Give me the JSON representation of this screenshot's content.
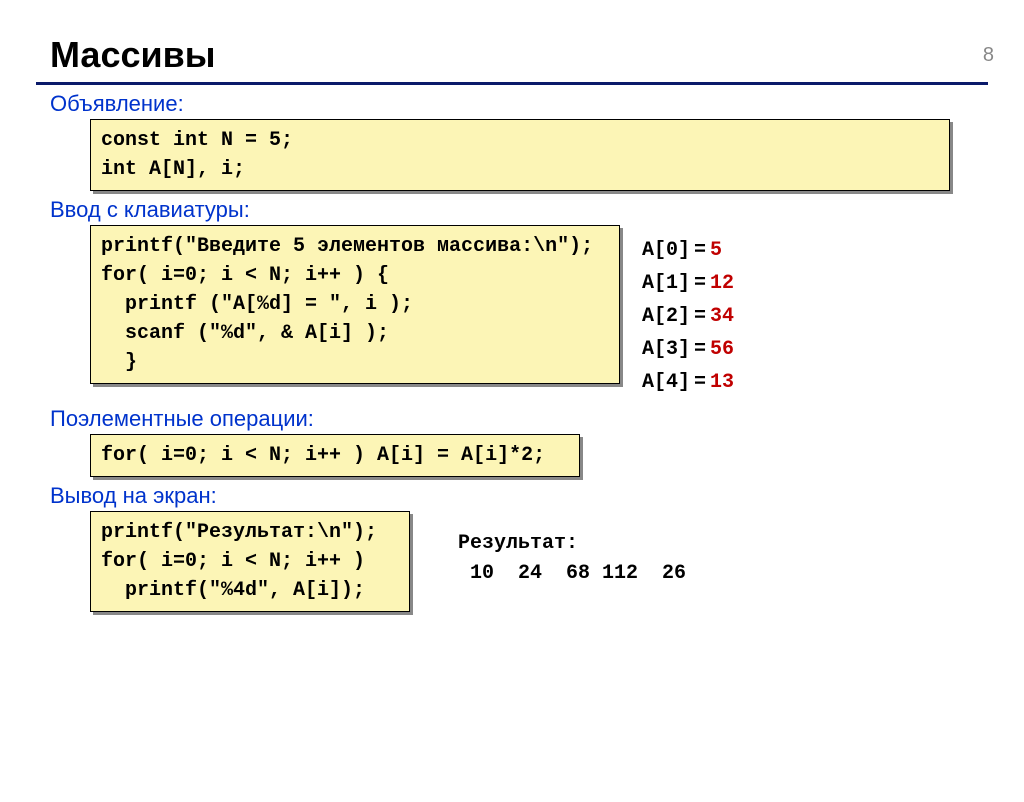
{
  "slide_number": "8",
  "title": "Массивы",
  "sections": {
    "declaration_label": "Объявление:",
    "input_label": "Ввод с клавиатуры:",
    "ops_label": "Поэлементные операции:",
    "output_label": "Вывод на экран:"
  },
  "code": {
    "declaration": "const int N = 5;\nint A[N], i;",
    "input": "printf(\"Введите 5 элементов массива:\\n\");\nfor( i=0; i < N; i++ ) {\n  printf (\"A[%d] = \", i );\n  scanf (\"%d\", & A[i] );\n  }",
    "ops": "for( i=0; i < N; i++ ) A[i] = A[i]*2;",
    "output": "printf(\"Результат:\\n\");\nfor( i=0; i < N; i++ )\n  printf(\"%4d\", A[i]);"
  },
  "input_sample": [
    {
      "key": "A[0]",
      "val": "5"
    },
    {
      "key": "A[1]",
      "val": "12"
    },
    {
      "key": "A[2]",
      "val": "34"
    },
    {
      "key": "A[3]",
      "val": "56"
    },
    {
      "key": "A[4]",
      "val": "13"
    }
  ],
  "result": {
    "label": "Результат:",
    "values": " 10  24  68 112  26"
  }
}
